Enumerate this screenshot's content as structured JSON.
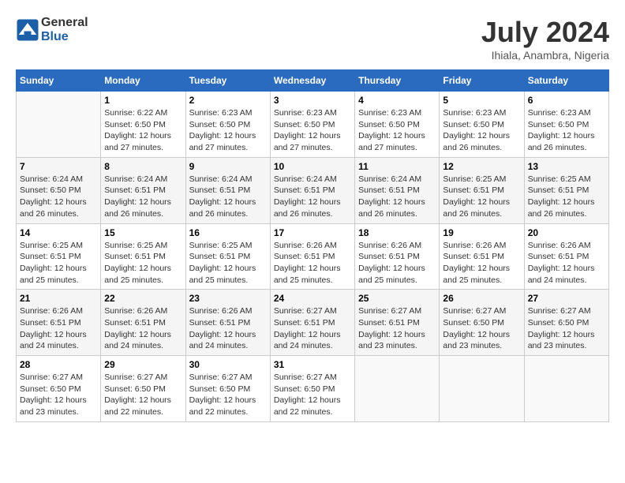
{
  "header": {
    "logo_general": "General",
    "logo_blue": "Blue",
    "main_title": "July 2024",
    "subtitle": "Ihiala, Anambra, Nigeria"
  },
  "columns": [
    "Sunday",
    "Monday",
    "Tuesday",
    "Wednesday",
    "Thursday",
    "Friday",
    "Saturday"
  ],
  "weeks": [
    [
      {
        "day": "",
        "info": ""
      },
      {
        "day": "1",
        "info": "Sunrise: 6:22 AM\nSunset: 6:50 PM\nDaylight: 12 hours\nand 27 minutes."
      },
      {
        "day": "2",
        "info": "Sunrise: 6:23 AM\nSunset: 6:50 PM\nDaylight: 12 hours\nand 27 minutes."
      },
      {
        "day": "3",
        "info": "Sunrise: 6:23 AM\nSunset: 6:50 PM\nDaylight: 12 hours\nand 27 minutes."
      },
      {
        "day": "4",
        "info": "Sunrise: 6:23 AM\nSunset: 6:50 PM\nDaylight: 12 hours\nand 27 minutes."
      },
      {
        "day": "5",
        "info": "Sunrise: 6:23 AM\nSunset: 6:50 PM\nDaylight: 12 hours\nand 26 minutes."
      },
      {
        "day": "6",
        "info": "Sunrise: 6:23 AM\nSunset: 6:50 PM\nDaylight: 12 hours\nand 26 minutes."
      }
    ],
    [
      {
        "day": "7",
        "info": "Sunrise: 6:24 AM\nSunset: 6:50 PM\nDaylight: 12 hours\nand 26 minutes."
      },
      {
        "day": "8",
        "info": "Sunrise: 6:24 AM\nSunset: 6:51 PM\nDaylight: 12 hours\nand 26 minutes."
      },
      {
        "day": "9",
        "info": "Sunrise: 6:24 AM\nSunset: 6:51 PM\nDaylight: 12 hours\nand 26 minutes."
      },
      {
        "day": "10",
        "info": "Sunrise: 6:24 AM\nSunset: 6:51 PM\nDaylight: 12 hours\nand 26 minutes."
      },
      {
        "day": "11",
        "info": "Sunrise: 6:24 AM\nSunset: 6:51 PM\nDaylight: 12 hours\nand 26 minutes."
      },
      {
        "day": "12",
        "info": "Sunrise: 6:25 AM\nSunset: 6:51 PM\nDaylight: 12 hours\nand 26 minutes."
      },
      {
        "day": "13",
        "info": "Sunrise: 6:25 AM\nSunset: 6:51 PM\nDaylight: 12 hours\nand 26 minutes."
      }
    ],
    [
      {
        "day": "14",
        "info": "Sunrise: 6:25 AM\nSunset: 6:51 PM\nDaylight: 12 hours\nand 25 minutes."
      },
      {
        "day": "15",
        "info": "Sunrise: 6:25 AM\nSunset: 6:51 PM\nDaylight: 12 hours\nand 25 minutes."
      },
      {
        "day": "16",
        "info": "Sunrise: 6:25 AM\nSunset: 6:51 PM\nDaylight: 12 hours\nand 25 minutes."
      },
      {
        "day": "17",
        "info": "Sunrise: 6:26 AM\nSunset: 6:51 PM\nDaylight: 12 hours\nand 25 minutes."
      },
      {
        "day": "18",
        "info": "Sunrise: 6:26 AM\nSunset: 6:51 PM\nDaylight: 12 hours\nand 25 minutes."
      },
      {
        "day": "19",
        "info": "Sunrise: 6:26 AM\nSunset: 6:51 PM\nDaylight: 12 hours\nand 25 minutes."
      },
      {
        "day": "20",
        "info": "Sunrise: 6:26 AM\nSunset: 6:51 PM\nDaylight: 12 hours\nand 24 minutes."
      }
    ],
    [
      {
        "day": "21",
        "info": "Sunrise: 6:26 AM\nSunset: 6:51 PM\nDaylight: 12 hours\nand 24 minutes."
      },
      {
        "day": "22",
        "info": "Sunrise: 6:26 AM\nSunset: 6:51 PM\nDaylight: 12 hours\nand 24 minutes."
      },
      {
        "day": "23",
        "info": "Sunrise: 6:26 AM\nSunset: 6:51 PM\nDaylight: 12 hours\nand 24 minutes."
      },
      {
        "day": "24",
        "info": "Sunrise: 6:27 AM\nSunset: 6:51 PM\nDaylight: 12 hours\nand 24 minutes."
      },
      {
        "day": "25",
        "info": "Sunrise: 6:27 AM\nSunset: 6:51 PM\nDaylight: 12 hours\nand 23 minutes."
      },
      {
        "day": "26",
        "info": "Sunrise: 6:27 AM\nSunset: 6:50 PM\nDaylight: 12 hours\nand 23 minutes."
      },
      {
        "day": "27",
        "info": "Sunrise: 6:27 AM\nSunset: 6:50 PM\nDaylight: 12 hours\nand 23 minutes."
      }
    ],
    [
      {
        "day": "28",
        "info": "Sunrise: 6:27 AM\nSunset: 6:50 PM\nDaylight: 12 hours\nand 23 minutes."
      },
      {
        "day": "29",
        "info": "Sunrise: 6:27 AM\nSunset: 6:50 PM\nDaylight: 12 hours\nand 22 minutes."
      },
      {
        "day": "30",
        "info": "Sunrise: 6:27 AM\nSunset: 6:50 PM\nDaylight: 12 hours\nand 22 minutes."
      },
      {
        "day": "31",
        "info": "Sunrise: 6:27 AM\nSunset: 6:50 PM\nDaylight: 12 hours\nand 22 minutes."
      },
      {
        "day": "",
        "info": ""
      },
      {
        "day": "",
        "info": ""
      },
      {
        "day": "",
        "info": ""
      }
    ]
  ]
}
